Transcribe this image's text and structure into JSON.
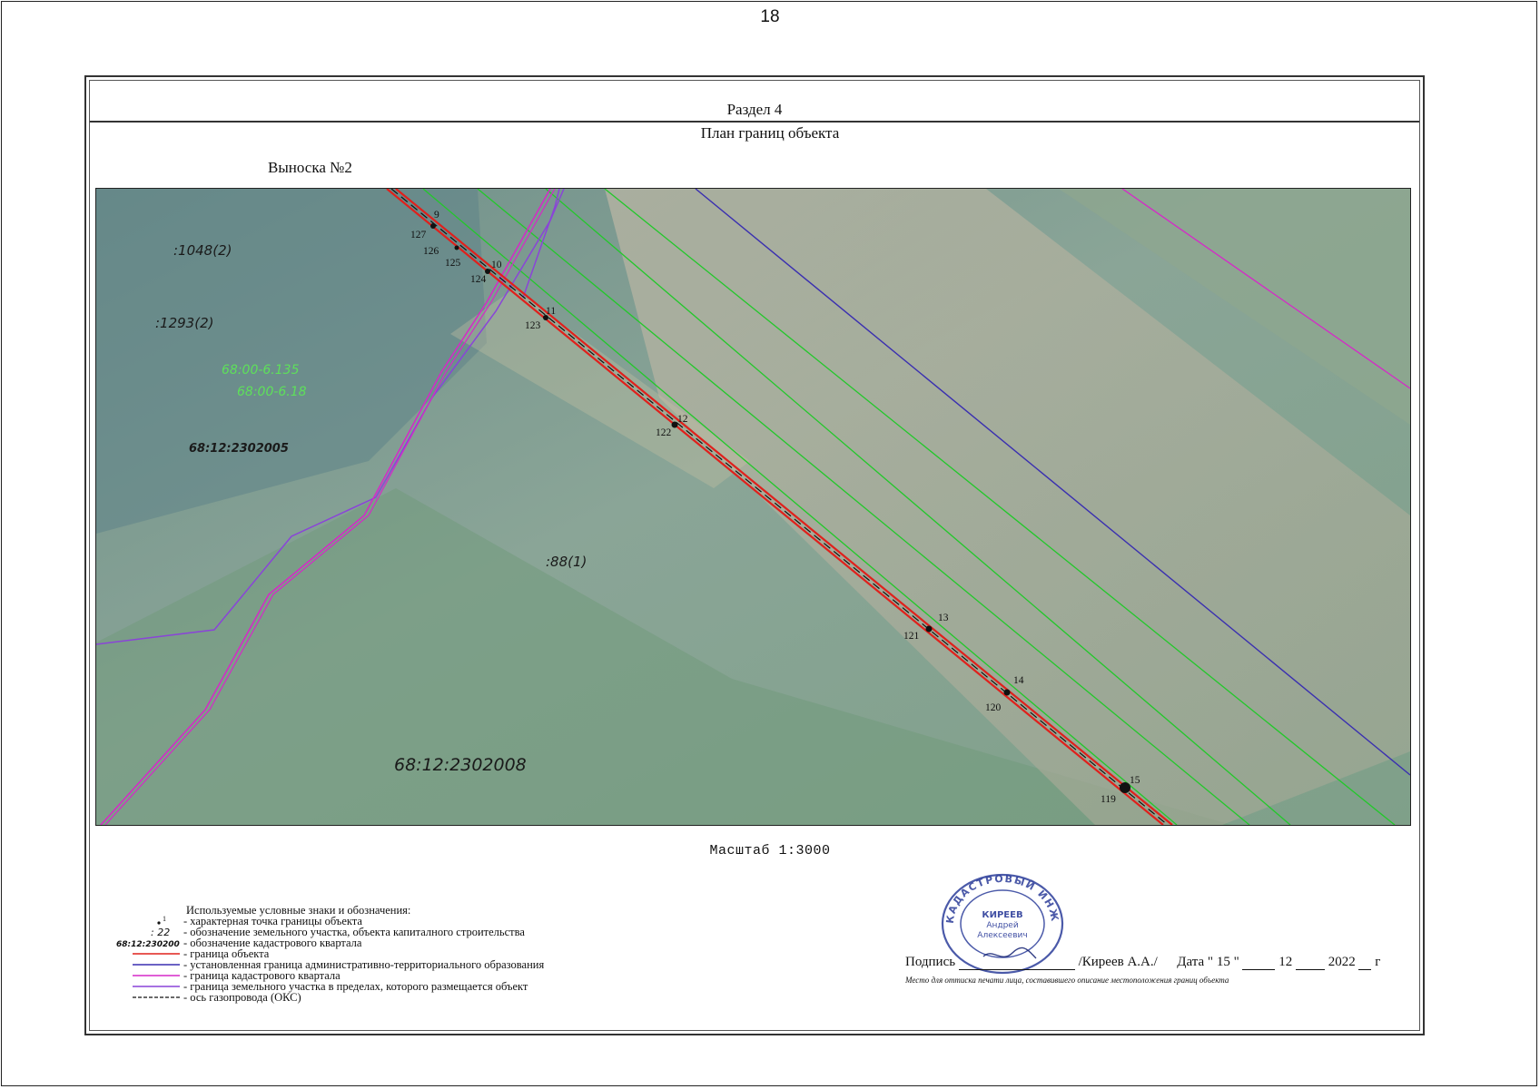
{
  "page_number": "18",
  "section": {
    "title": "Раздел 4"
  },
  "plan_title": "План границ объекта",
  "callout_title": "Выноска №2",
  "map": {
    "area_labels": [
      {
        "id": "parcel-1048",
        "text": ":1048(2)"
      },
      {
        "id": "parcel-1293",
        "text": ":1293(2)"
      },
      {
        "id": "zone-135",
        "text": "68:00-6.135"
      },
      {
        "id": "zone-18",
        "text": "68:00-6.18"
      },
      {
        "id": "quarter-2302005",
        "text": "68:12:2302005"
      },
      {
        "id": "parcel-88",
        "text": ":88(1)"
      },
      {
        "id": "quarter-2302008",
        "text": "68:12:2302008"
      }
    ],
    "points": [
      {
        "a": "9",
        "b": "127"
      },
      {
        "a": "126",
        "b": "125"
      },
      {
        "a": "10",
        "b": "124"
      },
      {
        "a": "11",
        "b": "123"
      },
      {
        "a": "12",
        "b": "122"
      },
      {
        "a": "13",
        "b": "121"
      },
      {
        "a": "14",
        "b": "120"
      },
      {
        "a": "15",
        "b": "119"
      }
    ],
    "colors": {
      "object_boundary": "#e0201c",
      "admin_boundary": "#3a2fb0",
      "cadastral_quarter": "#d628c8",
      "parcel_boundary": "#8a44d8",
      "zone": "#22c82a",
      "gas_axis": "#111111"
    }
  },
  "scale_text": "Масштаб 1:3000",
  "legend": {
    "title": "Используемые условные знаки и обозначения:",
    "items": [
      {
        "symbol": "point",
        "symbol_text": "1",
        "text": "- характерная точка границы объекта"
      },
      {
        "symbol": "text",
        "symbol_text": ": 22",
        "text": "- обозначение земельного участка, объекта капиталного строительства"
      },
      {
        "symbol": "text",
        "symbol_text": "68:12:2302005",
        "text": "- обозначение кадастрового квартала"
      },
      {
        "symbol": "line",
        "color": "#e0201c",
        "text": "- граница объекта"
      },
      {
        "symbol": "line",
        "color": "#3a2fb0",
        "text": "- установленная граница административно-территориального образования"
      },
      {
        "symbol": "line",
        "color": "#d628c8",
        "text": "- граница кадастрового квартала"
      },
      {
        "symbol": "line",
        "color": "#8a44d8",
        "text": "- граница земельного участка в пределах, которого размещается объект"
      },
      {
        "symbol": "dashed",
        "color": "#111111",
        "text": "- ось газопровода (ОКС)"
      }
    ]
  },
  "signature": {
    "label": "Подпись",
    "name": "/Киреев А.А./",
    "date_label": "Дата \"",
    "day": "15",
    "month": "12",
    "year": "2022",
    "year_suffix": "г",
    "note": "Место для оттиска печати лица, составившего описание местоположения границ объекта"
  },
  "stamp": {
    "ring_text": "КАДАСТРОВЫЙ ИНЖЕНЕР",
    "line1": "КИРЕЕВ",
    "line2": "Андрей",
    "line3": "Алексеевич"
  }
}
